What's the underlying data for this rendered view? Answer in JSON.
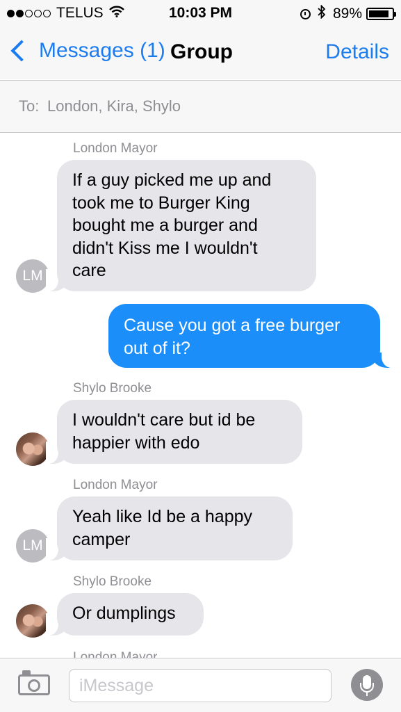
{
  "status_bar": {
    "signal_bars_filled": 2,
    "signal_bars_total": 5,
    "carrier": "TELUS",
    "time": "10:03 PM",
    "battery_percent": "89%",
    "battery_level": 0.89,
    "icons": [
      "wifi-icon",
      "alarm-icon",
      "bluetooth-icon",
      "battery-icon"
    ]
  },
  "nav": {
    "back_label": "Messages (1)",
    "title": "Group",
    "details_label": "Details"
  },
  "recipients": {
    "to_label": "To:",
    "names": "London, Kira, Shylo"
  },
  "conversation": {
    "messages": [
      {
        "sender": "London Mayor",
        "direction": "incoming",
        "avatar_initials": "LM",
        "lines": [
          "If a guy picked me up and",
          "took me to Burger King",
          "bought me a burger and",
          "didn't Kiss me I wouldn't",
          "care"
        ]
      },
      {
        "direction": "outgoing",
        "lines": [
          "Cause you got a free burger",
          "out of it?"
        ]
      },
      {
        "sender": "Shylo Brooke",
        "direction": "incoming",
        "avatar": "photo",
        "lines": [
          "I wouldn't care but id be",
          "happier with edo"
        ]
      },
      {
        "sender": "London Mayor",
        "direction": "incoming",
        "avatar_initials": "LM",
        "lines": [
          "Yeah like Id be a happy",
          "camper"
        ]
      },
      {
        "sender": "Shylo Brooke",
        "direction": "incoming",
        "avatar": "photo",
        "lines": [
          "Or dumplings"
        ]
      }
    ],
    "partial_sender": "London Mayor"
  },
  "input_bar": {
    "placeholder": "iMessage",
    "value": ""
  },
  "colors": {
    "accent": "#1b7cf0",
    "outgoing_bubble": "#1c8ef9",
    "incoming_bubble": "#e5e5ea",
    "secondary_text": "#8e8e93"
  }
}
